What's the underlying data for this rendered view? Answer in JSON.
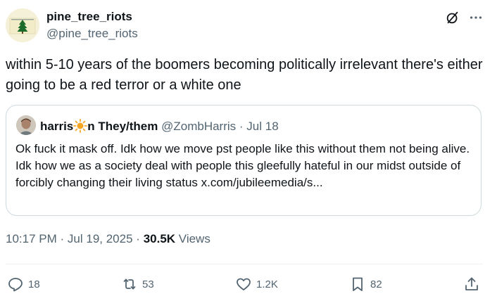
{
  "author": {
    "name": "pine_tree_riots",
    "handle": "@pine_tree_riots"
  },
  "tweet": {
    "text": "within 5-10 years of the boomers becoming politically irrelevant there's either going to be a red terror or a white one"
  },
  "quote": {
    "name_part1": "harris",
    "name_part2": "n They/them",
    "handle": "@ZombHarris",
    "separator": "·",
    "date": "Jul 18",
    "text": "Ok fuck it mask off. Idk how we move pst people like this without them not being alive. Idk how we as a society deal with people this gleefully hateful in our midst outside of forcibly changing their living status x.com/jubileemedia/s..."
  },
  "meta": {
    "time": "10:17 PM",
    "separator1": "·",
    "date": "Jul 19, 2025",
    "separator2": "·",
    "views_count": "30.5K",
    "views_label": "Views"
  },
  "actions": {
    "replies": "18",
    "reposts": "53",
    "likes": "1.2K",
    "bookmarks": "82"
  },
  "icons": [
    "grok-icon",
    "more-icon",
    "reply-icon",
    "repost-icon",
    "like-icon",
    "bookmark-icon",
    "share-icon",
    "sun-emoji-icon"
  ],
  "colors": {
    "text": "#0f1419",
    "secondary": "#536471",
    "border": "#cfd9de",
    "flag_background": "#f4efd7",
    "flag_tree": "#1d6b2a"
  }
}
